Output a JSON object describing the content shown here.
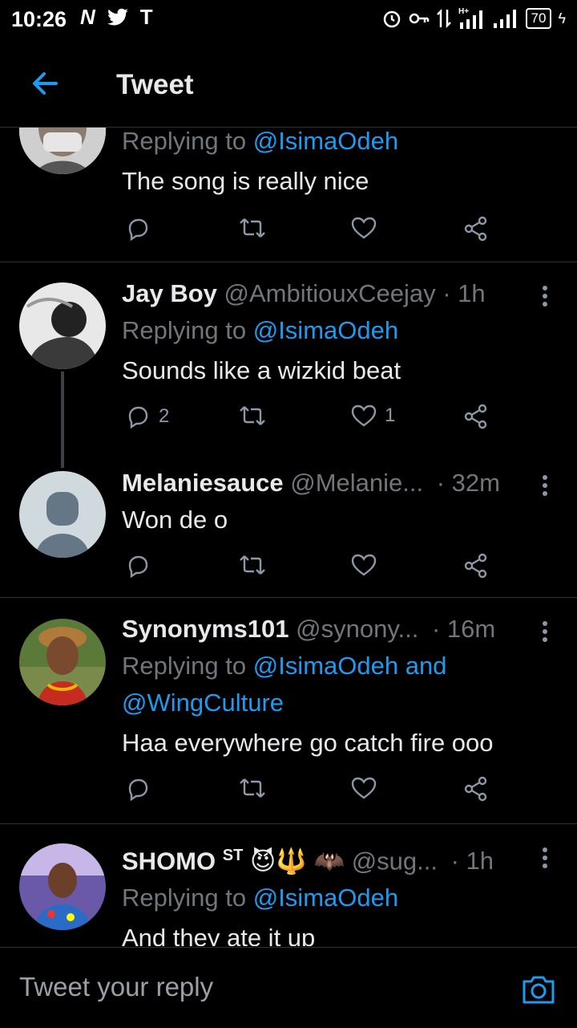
{
  "status_bar": {
    "time": "10:26",
    "left_icons": [
      "N",
      "twitter-bird",
      "T"
    ],
    "battery": "70"
  },
  "header": {
    "title": "Tweet"
  },
  "tweets": [
    {
      "replying_prefix": "Replying to ",
      "replying_to": "@IsimaOdeh",
      "text": "The song is really nice",
      "replies": "",
      "likes": ""
    },
    {
      "name": "Jay Boy",
      "handle": "@AmbitiouxCeejay",
      "time": "· 1h",
      "replying_prefix": "Replying to ",
      "replying_to": "@IsimaOdeh",
      "text": "Sounds like a wizkid beat",
      "replies": "2",
      "likes": "1"
    },
    {
      "name": "Melaniesauce",
      "handle": "@Melanie...",
      "time": "· 32m",
      "text": "Won de o",
      "replies": "",
      "likes": ""
    },
    {
      "name": "Synonyms101",
      "handle": "@synony...",
      "time": "· 16m",
      "replying_prefix": "Replying to ",
      "replying_to": "@IsimaOdeh and",
      "replying_to_2": "@WingCulture",
      "text": "Haa everywhere go catch fire ooo",
      "replies": "",
      "likes": ""
    },
    {
      "name": "SHOMO",
      "name_sup": "ST",
      "name_emoji": "😈🔱 🦇",
      "handle": "@sug...",
      "time": "· 1h",
      "replying_prefix": "Replying to ",
      "replying_to": "@IsimaOdeh",
      "text": "And they ate it up"
    }
  ],
  "reply": {
    "placeholder": "Tweet your reply"
  },
  "colors": {
    "accent": "#1d9bf0",
    "background": "#000000",
    "muted": "#71767b",
    "divider": "#2f3336"
  }
}
